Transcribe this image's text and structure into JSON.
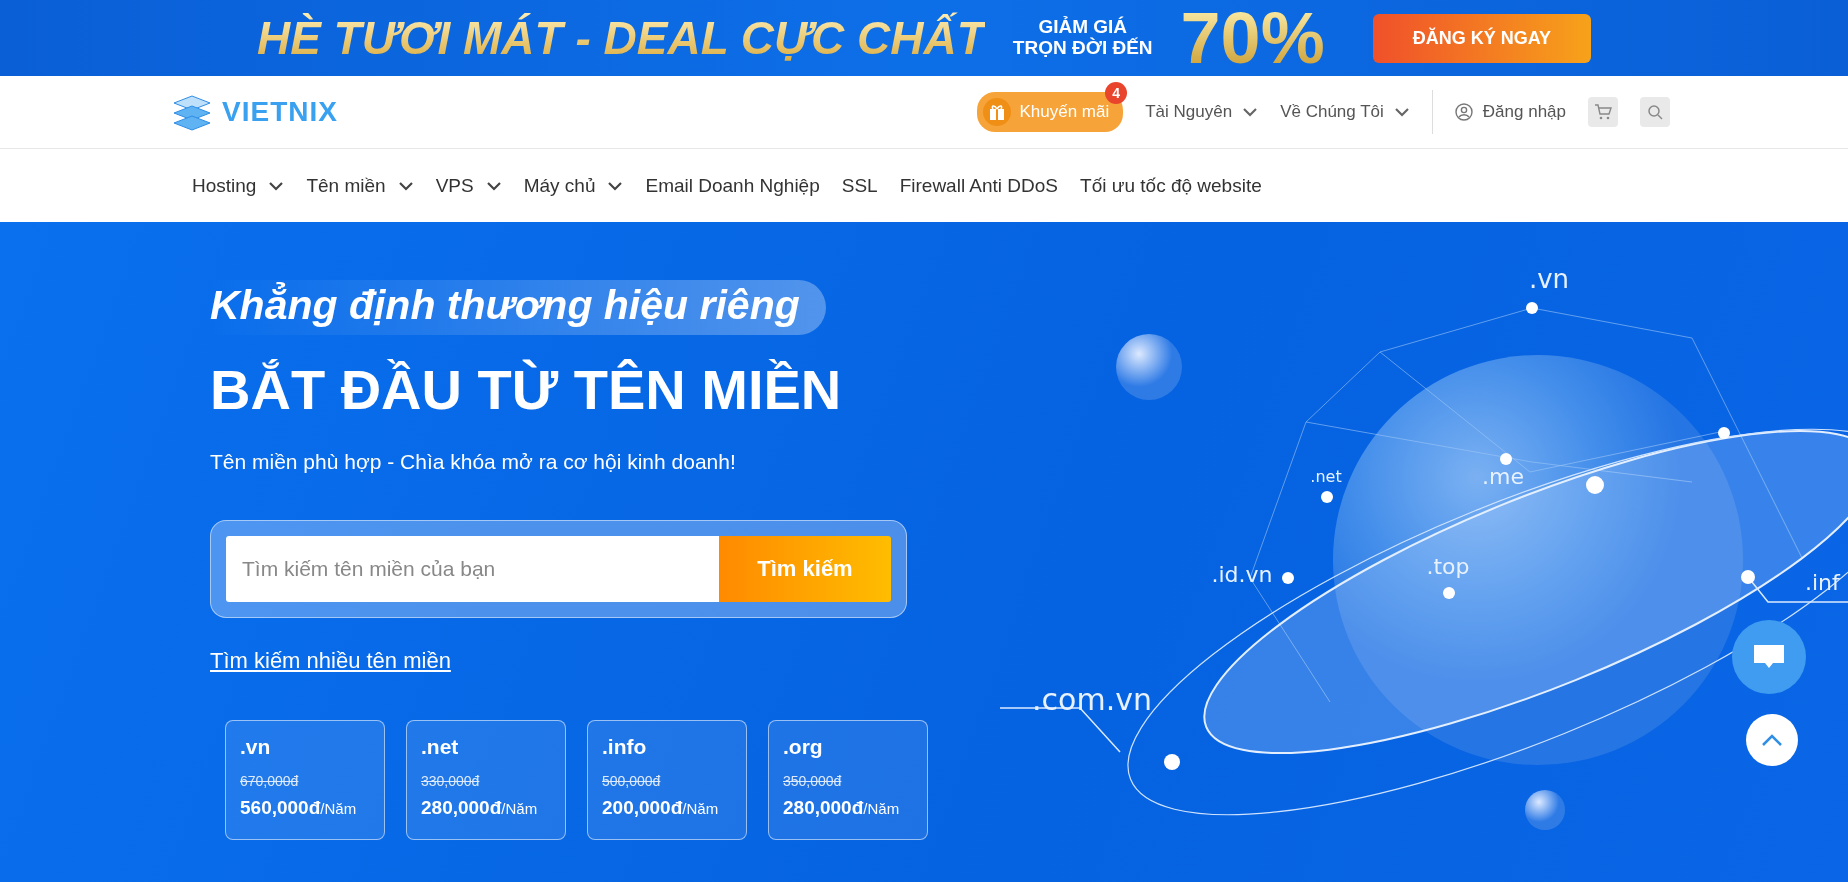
{
  "banner": {
    "headline": "HÈ TƯƠI MÁT - DEAL CỰC CHẤT",
    "discount_lines": [
      "GIẢM GIÁ",
      "TRỌN ĐỜI ĐẾN"
    ],
    "discount": "70%",
    "cta": "ĐĂNG KÝ NGAY"
  },
  "header": {
    "logo": "VIETNIX",
    "promo": {
      "label": "Khuyến mãi",
      "badge": "4"
    },
    "links": [
      {
        "label": "Tài Nguyên",
        "has_dropdown": true
      },
      {
        "label": "Về Chúng Tôi",
        "has_dropdown": true
      }
    ],
    "login": "Đăng nhập"
  },
  "nav": [
    {
      "label": "Hosting",
      "has_dropdown": true
    },
    {
      "label": "Tên miền",
      "has_dropdown": true
    },
    {
      "label": "VPS",
      "has_dropdown": true
    },
    {
      "label": "Máy chủ",
      "has_dropdown": true
    },
    {
      "label": "Email Doanh Nghiệp",
      "has_dropdown": false
    },
    {
      "label": "SSL",
      "has_dropdown": false
    },
    {
      "label": "Firewall Anti DDoS",
      "has_dropdown": false
    },
    {
      "label": "Tối ưu tốc độ website",
      "has_dropdown": false
    }
  ],
  "hero": {
    "tagline": "Khẳng định thương hiệu riêng",
    "title": "BẮT ĐẦU TỪ TÊN MIỀN",
    "subtitle": "Tên miền phù hợp - Chìa khóa mở ra cơ hội kinh doanh!",
    "search": {
      "placeholder": "Tìm kiếm tên miền của bạn",
      "button": "Tìm kiếm"
    },
    "multi_search_link": "Tìm kiếm nhiều tên miền",
    "prices": [
      {
        "tld": ".vn",
        "old_price": "670,000đ",
        "price": "560,000đ",
        "unit": "/Năm"
      },
      {
        "tld": ".net",
        "old_price": "330,000đ",
        "price": "280,000đ",
        "unit": "/Năm"
      },
      {
        "tld": ".info",
        "old_price": "500,000đ",
        "price": "200,000đ",
        "unit": "/Năm"
      },
      {
        "tld": ".org",
        "old_price": "350,000đ",
        "price": "280,000đ",
        "unit": "/Năm"
      }
    ],
    "globe_labels": [
      ".vn",
      ".net",
      ".me",
      ".id.vn",
      ".top",
      ".com.vn",
      ".inf"
    ]
  }
}
